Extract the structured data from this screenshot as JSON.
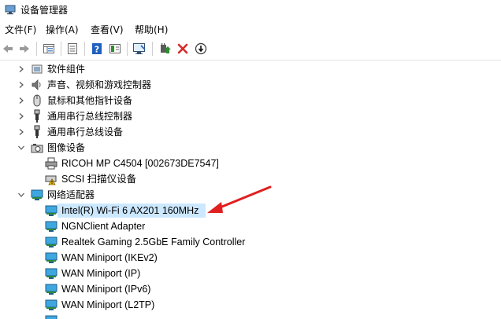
{
  "window": {
    "title": "设备管理器"
  },
  "menu": {
    "file": "文件(F)",
    "action": "操作(A)",
    "view": "查看(V)",
    "help": "帮助(H)"
  },
  "toolbar": {
    "icons": [
      "back-arrow-icon",
      "forward-arrow-icon",
      "properties-icon",
      "grid-icon",
      "help-icon",
      "device-panel-icon",
      "monitor-scan-icon",
      "update-driver-icon",
      "uninstall-icon",
      "disable-icon"
    ],
    "colors": {
      "uninstall": "#d62a2a",
      "update_green": "#2d8f2d",
      "help_blue": "#1f5fbf"
    }
  },
  "tree": {
    "categories": [
      {
        "label": "软件组件",
        "icon": "software-component-icon",
        "expanded": false
      },
      {
        "label": "声音、视频和游戏控制器",
        "icon": "speaker-icon",
        "expanded": false
      },
      {
        "label": "鼠标和其他指针设备",
        "icon": "mouse-icon",
        "expanded": false
      },
      {
        "label": "通用串行总线控制器",
        "icon": "usb-icon",
        "expanded": false
      },
      {
        "label": "通用串行总线设备",
        "icon": "usb-icon",
        "expanded": false
      },
      {
        "label": "图像设备",
        "icon": "camera-icon",
        "expanded": true,
        "children": [
          {
            "label": "RICOH MP C4504 [002673DE7547]",
            "icon": "printer-icon"
          },
          {
            "label": "SCSI 扫描仪设备",
            "icon": "scanner-warning-icon"
          }
        ]
      },
      {
        "label": "网络适配器",
        "icon": "network-adapter-icon",
        "expanded": true,
        "children": [
          {
            "label": "Intel(R) Wi-Fi 6 AX201 160MHz",
            "icon": "network-adapter-icon",
            "selected": true
          },
          {
            "label": "NGNClient Adapter",
            "icon": "network-adapter-icon"
          },
          {
            "label": "Realtek Gaming 2.5GbE Family Controller",
            "icon": "network-adapter-icon"
          },
          {
            "label": "WAN Miniport (IKEv2)",
            "icon": "network-adapter-icon"
          },
          {
            "label": "WAN Miniport (IP)",
            "icon": "network-adapter-icon"
          },
          {
            "label": "WAN Miniport (IPv6)",
            "icon": "network-adapter-icon"
          },
          {
            "label": "WAN Miniport (L2TP)",
            "icon": "network-adapter-icon"
          }
        ]
      }
    ]
  },
  "annotation": {
    "icon": "red-arrow-icon",
    "color": "#e02020"
  }
}
